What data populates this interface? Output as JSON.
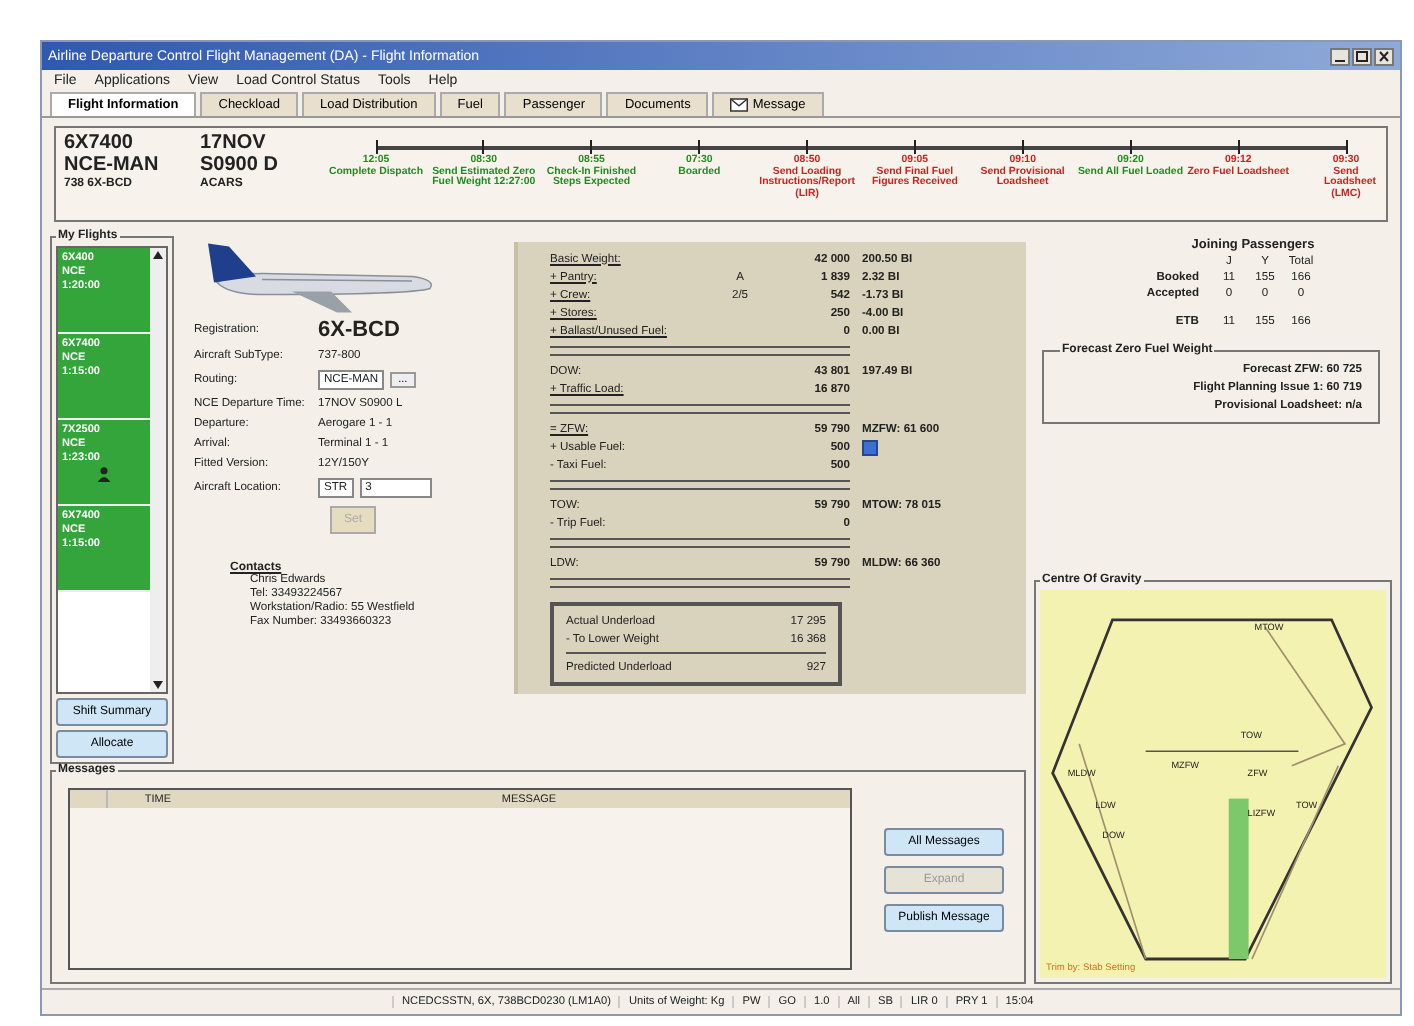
{
  "window": {
    "title": "Airline Departure Control Flight Management (DA) - Flight Information"
  },
  "menu": [
    "File",
    "Applications",
    "View",
    "Load Control Status",
    "Tools",
    "Help"
  ],
  "tabs": [
    {
      "label": "Flight Information",
      "selected": true,
      "kind": "plain"
    },
    {
      "label": "Checkload",
      "selected": false,
      "kind": "plain"
    },
    {
      "label": "Load Distribution",
      "selected": false,
      "kind": "plain"
    },
    {
      "label": "Fuel",
      "selected": false,
      "kind": "plain"
    },
    {
      "label": "Passenger",
      "selected": false,
      "kind": "plain"
    },
    {
      "label": "Documents",
      "selected": false,
      "kind": "plain"
    },
    {
      "label": "Message",
      "selected": false,
      "kind": "icon"
    }
  ],
  "flight_header": {
    "flight": "6X7400",
    "route": "NCE-MAN",
    "aircraft": "738 6X-BCD",
    "date": "17NOV",
    "std": "S0900 D",
    "source": "ACARS"
  },
  "timeline": [
    {
      "time": "12:05",
      "label": "Complete Dispatch",
      "color": "#1e8c1e"
    },
    {
      "time": "08:30",
      "label": "Send Estimated Zero Fuel Weight 12:27:00",
      "color": "#1e8c1e"
    },
    {
      "time": "08:55",
      "label": "Check-In Finished Steps Expected",
      "color": "#1e8c1e"
    },
    {
      "time": "07:30",
      "label": "Boarded",
      "color": "#1e8c1e"
    },
    {
      "time": "08:50",
      "label": "Send Loading Instructions/Report (LIR)",
      "color": "#d01e1e"
    },
    {
      "time": "09:05",
      "label": "Send Final Fuel Figures Received",
      "color": "#d01e1e"
    },
    {
      "time": "09:10",
      "label": "Send Provisional Loadsheet",
      "color": "#d01e1e"
    },
    {
      "time": "09:20",
      "label": "Send All Fuel Loaded",
      "color": "#1e8c1e"
    },
    {
      "time": "09:12",
      "label": "Zero Fuel Loadsheet",
      "color": "#d01e1e"
    },
    {
      "time": "09:30",
      "label": "Send Loadsheet (LMC)",
      "color": "#d01e1e"
    }
  ],
  "my_flights": {
    "title": "My Flights",
    "items": [
      {
        "flight": "6X400",
        "station": "NCE",
        "time": "1:20:00",
        "assigned": false
      },
      {
        "flight": "6X7400",
        "station": "NCE",
        "time": "1:15:00",
        "assigned": false
      },
      {
        "flight": "7X2500",
        "station": "NCE",
        "time": "1:23:00",
        "assigned": true
      },
      {
        "flight": "6X7400",
        "station": "NCE",
        "time": "1:15:00",
        "assigned": false
      }
    ],
    "buttons": [
      "Shift Summary",
      "Allocate"
    ]
  },
  "details": {
    "fields": [
      {
        "label": "Registration:",
        "kind": "big",
        "values": [
          "6X-BCD"
        ]
      },
      {
        "label": "Aircraft SubType:",
        "kind": "text",
        "values": [
          "737-800"
        ]
      },
      {
        "label": "Routing:",
        "kind": "combo",
        "values": [
          "NCE-MAN",
          "..."
        ]
      },
      {
        "label": "NCE Departure Time:",
        "kind": "text",
        "values": [
          "17NOV S0900 L"
        ]
      },
      {
        "label": "Departure:",
        "kind": "text",
        "values": [
          "Aerogare 1 - 1"
        ]
      },
      {
        "label": "Arrival:",
        "kind": "text",
        "values": [
          "Terminal 1 - 1"
        ]
      },
      {
        "label": "Fitted Version:",
        "kind": "text",
        "values": [
          "12Y/150Y"
        ]
      },
      {
        "label": "Aircraft Location:",
        "kind": "inputs",
        "values": [
          "STR",
          "3"
        ]
      }
    ],
    "set_button": {
      "label": "Set",
      "disabled": true
    },
    "contacts": {
      "title": "Contacts",
      "lines": [
        "Chris Edwards",
        "Tel: 33493224567",
        "Workstation/Radio: 55 Westfield",
        "Fax Number: 33493660323"
      ]
    }
  },
  "weights": {
    "sections": [
      [
        {
          "label": "Basic Weight:",
          "link": true,
          "col_3": "42 000",
          "col_4": "200.50 BI",
          "button": false
        },
        {
          "label": "+ Pantry:",
          "link": true,
          "col_2": "A",
          "col_3": "1 839",
          "col_4": "2.32 BI",
          "button": false
        },
        {
          "label": "+ Crew:",
          "link": true,
          "col_2": "2/5",
          "col_3": "542",
          "col_4": "-1.73 BI",
          "button": false
        },
        {
          "label": "+ Stores:",
          "link": true,
          "col_3": "250",
          "col_4": "-4.00 BI",
          "button": false
        },
        {
          "label": "+ Ballast/Unused Fuel:",
          "link": true,
          "col_3": "0",
          "col_4": "0.00 BI",
          "button": false
        }
      ],
      [
        {
          "label": "DOW:",
          "link": false,
          "col_3": "43 801",
          "col_4": "197.49 BI",
          "button": false
        },
        {
          "label": "+ Traffic Load:",
          "link": true,
          "col_3": "16 870",
          "button": false
        }
      ],
      [
        {
          "label": "= ZFW:",
          "link": true,
          "col_3": "59 790",
          "col_4": "MZFW: 61 600",
          "button": false
        },
        {
          "label": "+ Usable Fuel:",
          "link": false,
          "col_3": "500",
          "button": true
        },
        {
          "label": "- Taxi Fuel:",
          "link": false,
          "col_3": "500",
          "button": false
        }
      ],
      [
        {
          "label": "TOW:",
          "link": false,
          "col_3": "59 790",
          "col_4": "MTOW: 78 015",
          "button": false
        },
        {
          "label": "- Trip Fuel:",
          "link": false,
          "col_3": "0",
          "button": false
        }
      ],
      [
        {
          "label": "LDW:",
          "link": false,
          "col_3": "59 790",
          "col_4": "MLDW: 66 360",
          "button": false
        }
      ]
    ],
    "underload": [
      {
        "label": "Actual Underload",
        "value": "17 295"
      },
      {
        "label": "- To Lower Weight",
        "value": "16 368"
      },
      {
        "label": "Predicted Underload",
        "value": "927"
      }
    ]
  },
  "joining_passengers": {
    "title": "Joining Passengers",
    "headers": [
      "J",
      "Y",
      "Total"
    ],
    "rows": [
      {
        "label": "Booked",
        "values": [
          "11",
          "155",
          "166"
        ]
      },
      {
        "label": "Accepted",
        "values": [
          "0",
          "0",
          "0"
        ]
      },
      {
        "label": "ETB",
        "values": [
          "11",
          "155",
          "166"
        ]
      }
    ]
  },
  "forecast_zfw": {
    "title": "Forecast Zero Fuel Weight",
    "rows": [
      {
        "label": "Forecast ZFW:",
        "value": "60 725"
      },
      {
        "label": "Flight Planning Issue 1:",
        "value": "60 719"
      },
      {
        "label": "Provisional Loadsheet:",
        "value": "n/a"
      }
    ]
  },
  "centre_of_gravity": {
    "title": "Centre Of Gravity",
    "labels": [
      "MTOW",
      "TOW",
      "MZFW",
      "ZFW",
      "MLDW",
      "LDW",
      "DOW",
      "LIZFW",
      "TOW"
    ],
    "footer": "Trim by: Stab Setting"
  },
  "messages": {
    "title": "Messages",
    "columns": [
      "TIME",
      "MESSAGE"
    ],
    "buttons": [
      {
        "label": "All Messages",
        "disabled": false
      },
      {
        "label": "Expand",
        "disabled": true
      },
      {
        "label": "Publish Message",
        "disabled": false
      }
    ]
  },
  "status_bar": [
    "NCEDCSSTN, 6X, 738BCD0230 (LM1A0)",
    "Units of Weight: Kg",
    "PW",
    "GO",
    "1.0",
    "All",
    "SB",
    "LIR 0",
    "PRY 1",
    "15:04"
  ]
}
